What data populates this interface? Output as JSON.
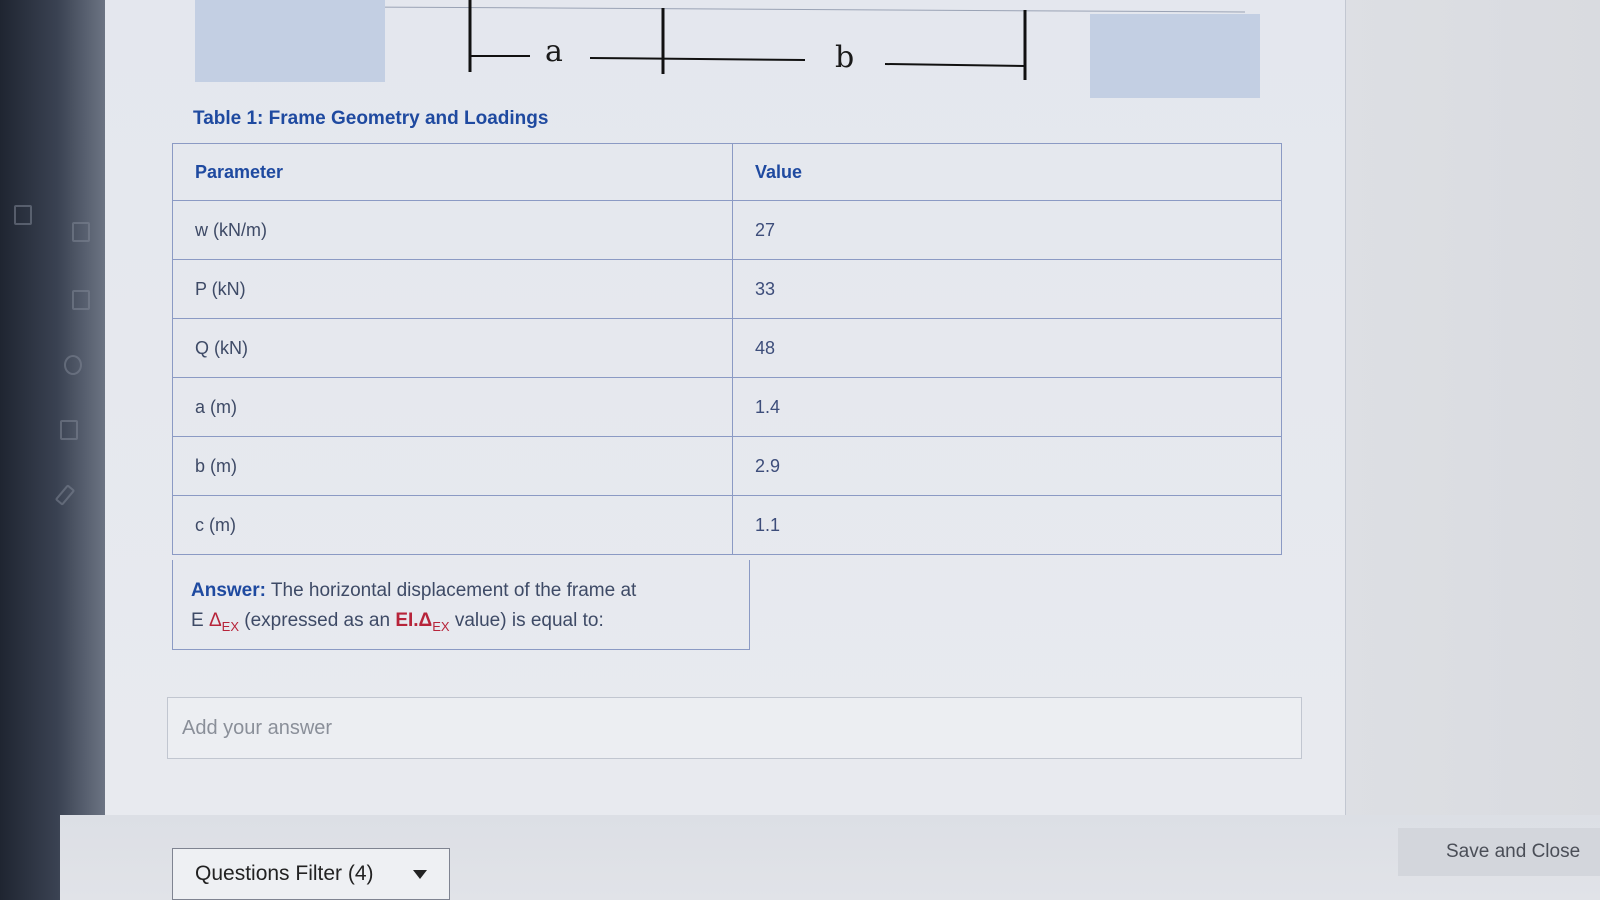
{
  "diagram": {
    "dim_a": "a",
    "dim_b": "b"
  },
  "table": {
    "caption": "Table 1: Frame Geometry and Loadings",
    "headers": [
      "Parameter",
      "Value"
    ],
    "rows": [
      {
        "param": "w (kN/m)",
        "value": "27"
      },
      {
        "param": "P (kN)",
        "value": "33"
      },
      {
        "param": "Q (kN)",
        "value": "48"
      },
      {
        "param": "a (m)",
        "value": "1.4"
      },
      {
        "param": "b (m)",
        "value": "2.9"
      },
      {
        "param": "c (m)",
        "value": "1.1"
      }
    ]
  },
  "answer": {
    "lead": "Answer:",
    "text1": " The horizontal displacement of the frame at",
    "line2_prefix": "E ",
    "delta1": "Δ",
    "sub1": "EX",
    "text2": " (expressed as an ",
    "ei": "EI.Δ",
    "sub2": "EX",
    "text3": " value) is equal to:"
  },
  "input": {
    "placeholder": "Add your answer",
    "value": ""
  },
  "footer": {
    "filter_label": "Questions Filter (4)",
    "save_label": "Save and Close"
  },
  "colors": {
    "accent": "#1f4aa0",
    "highlight": "#b7243a"
  }
}
